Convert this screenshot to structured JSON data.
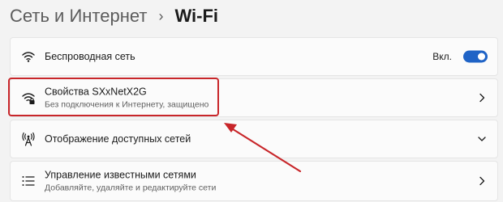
{
  "breadcrumb": {
    "parent": "Сеть и Интернет",
    "separator": "›",
    "current": "Wi-Fi"
  },
  "rows": [
    {
      "title": "Беспроводная сеть",
      "icon": "wifi-icon",
      "toggle_label": "Вкл.",
      "toggle_on": true
    },
    {
      "title": "Свойства SXxNetX2G",
      "subtitle": "Без подключения к Интернету, защищено",
      "icon": "wifi-lock-icon",
      "chevron": "chevron-right-icon"
    },
    {
      "title": "Отображение доступных сетей",
      "icon": "antenna-icon",
      "chevron": "chevron-down-icon"
    },
    {
      "title": "Управление известными сетями",
      "subtitle": "Добавляйте, удаляйте и редактируйте сети",
      "icon": "list-icon",
      "chevron": "chevron-right-icon"
    }
  ],
  "colors": {
    "accent": "#1f63c6",
    "annotation": "#c8262a",
    "background": "#f3f3f3",
    "card": "#fbfbfb"
  }
}
